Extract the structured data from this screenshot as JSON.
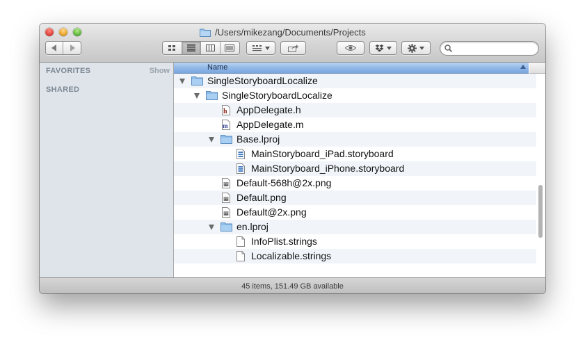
{
  "window": {
    "title": "/Users/mikezang/Documents/Projects",
    "status": "45 items, 151.49 GB available"
  },
  "toolbar": {
    "back_icon": "back-arrow-icon",
    "forward_icon": "forward-arrow-icon",
    "views": [
      "icon-view",
      "list-view",
      "column-view",
      "coverflow-view"
    ],
    "active_view": "list-view",
    "search": {
      "value": "",
      "placeholder": ""
    }
  },
  "sidebar": {
    "favorites": "FAVORITES",
    "show": "Show",
    "shared": "SHARED"
  },
  "list": {
    "column_header": "Name",
    "rows": [
      {
        "label": "SingleStoryboardLocalize",
        "icon": "folder-icon",
        "expanded": true
      },
      {
        "label": "SingleStoryboardLocalize",
        "icon": "folder-icon",
        "expanded": true
      },
      {
        "label": "AppDelegate.h",
        "icon": "h-file-icon"
      },
      {
        "label": "AppDelegate.m",
        "icon": "m-file-icon"
      },
      {
        "label": "Base.lproj",
        "icon": "folder-icon",
        "expanded": true
      },
      {
        "label": "MainStoryboard_iPad.storyboard",
        "icon": "storyboard-file-icon"
      },
      {
        "label": "MainStoryboard_iPhone.storyboard",
        "icon": "storyboard-file-icon"
      },
      {
        "label": "Default-568h@2x.png",
        "icon": "png-file-icon"
      },
      {
        "label": "Default.png",
        "icon": "png-file-icon"
      },
      {
        "label": "Default@2x.png",
        "icon": "png-file-icon"
      },
      {
        "label": "en.lproj",
        "icon": "folder-icon",
        "expanded": true
      },
      {
        "label": "InfoPlist.strings",
        "icon": "strings-file-icon"
      },
      {
        "label": "Localizable.strings",
        "icon": "strings-file-icon"
      }
    ]
  },
  "colors": {
    "sidebar_bg": "#dee4ea",
    "header_blue": "#8fb6e6",
    "folder_blue": "#8fbde8"
  }
}
